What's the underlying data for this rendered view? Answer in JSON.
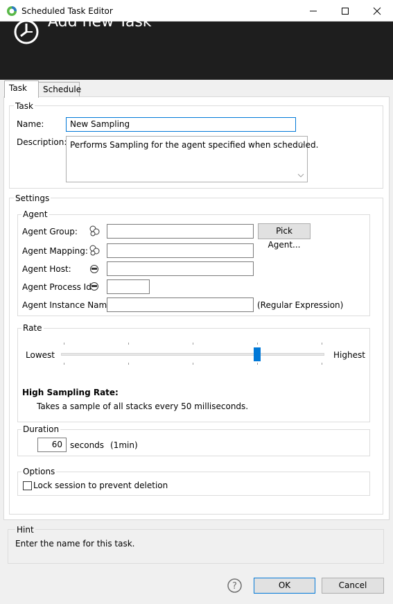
{
  "window": {
    "title": "Scheduled Task Editor"
  },
  "header": {
    "title": "Add new Task"
  },
  "tabs": [
    {
      "label": "Task"
    },
    {
      "label": "Schedule"
    }
  ],
  "task_group": {
    "title": "Task",
    "name_label": "Name:",
    "name_value": "New Sampling",
    "description_label": "Description:",
    "description_value": "Performs Sampling for the agent specified when scheduled."
  },
  "settings": {
    "title": "Settings",
    "agent": {
      "title": "Agent",
      "group_label": "Agent Group:",
      "pick_agent_button": "Pick Agent...",
      "mapping_label": "Agent Mapping:",
      "host_label": "Agent Host:",
      "process_id_label": "Agent Process Id:",
      "instance_name_label": "Agent Instance Name:",
      "instance_name_note": "(Regular Expression)",
      "group_value": "",
      "mapping_value": "",
      "host_value": "",
      "process_id_value": "",
      "instance_name_value": ""
    },
    "rate": {
      "title": "Rate",
      "min_label": "Lowest",
      "max_label": "Highest",
      "level_fraction": 0.75,
      "tick_count": 5,
      "description_title": "High Sampling Rate:",
      "description_text": "Takes a sample of all stacks every 50 milliseconds."
    },
    "duration": {
      "title": "Duration",
      "value": "60",
      "unit": "seconds",
      "readable": "(1min)"
    },
    "options": {
      "title": "Options",
      "lock_label": "Lock session to prevent deletion",
      "lock_checked": false
    }
  },
  "hint": {
    "title": "Hint",
    "text": "Enter the name for this task."
  },
  "buttons": {
    "ok": "OK",
    "cancel": "Cancel"
  },
  "colors": {
    "header_bg": "#1e1e1e",
    "accent": "#0078d7",
    "dialog_bg": "#f0f0f0"
  }
}
